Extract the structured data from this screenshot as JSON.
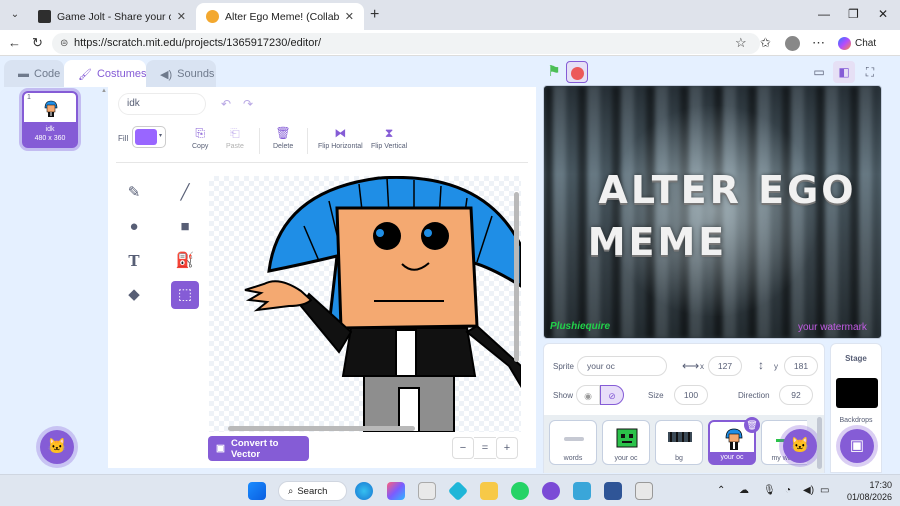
{
  "browser": {
    "tabs": [
      {
        "title": "Game Jolt - Share your creations",
        "active": false,
        "favicon_color": "#2e2e2e"
      },
      {
        "title": "Alter Ego Meme! (Collab) on Scrat",
        "active": true,
        "favicon_color": "#f3a82f"
      }
    ],
    "url": "https://scratch.mit.edu/projects/1365917230/editor/",
    "chat_label": "Chat"
  },
  "editor": {
    "tabs": {
      "code": "Code",
      "costumes": "Costumes",
      "sounds": "Sounds"
    },
    "costume_list": [
      {
        "index": "1",
        "name": "idk",
        "size": "480 x 360"
      }
    ],
    "paint": {
      "costume_name": "idk",
      "fill_label": "Fill",
      "fill_color": "#9966ff",
      "toolbar": {
        "copy": "Copy",
        "paste": "Paste",
        "delete": "Delete",
        "flip_horizontal": "Flip Horizontal",
        "flip_vertical": "Flip Vertical"
      },
      "convert_label": "Convert to Vector",
      "zoom": {
        "out": "−",
        "reset": "=",
        "in": "+"
      }
    }
  },
  "stage": {
    "title_line1": "ALTER EGO",
    "title_line2": "MEME",
    "watermark_left": "Plushiequire",
    "watermark_right": "your watermark"
  },
  "sprite_info": {
    "sprite_label": "Sprite",
    "sprite_name": "your oc",
    "x_label": "x",
    "x_value": "127",
    "y_label": "y",
    "y_value": "181",
    "show_label": "Show",
    "size_label": "Size",
    "size_value": "100",
    "direction_label": "Direction",
    "direction_value": "92"
  },
  "sprites": [
    {
      "name": "words"
    },
    {
      "name": "your oc"
    },
    {
      "name": "bg"
    },
    {
      "name": "your oc"
    },
    {
      "name": "my wa..."
    }
  ],
  "stage_pane": {
    "title": "Stage",
    "backdrops_label": "Backdrops"
  },
  "taskbar": {
    "search_label": "Search",
    "time": "17:30",
    "date": "01/08/2026"
  },
  "colors": {
    "accent": "#855cd6",
    "editor_bg": "#e5f0ff",
    "green_flag": "#4cbf56",
    "stop": "#ec5959"
  }
}
